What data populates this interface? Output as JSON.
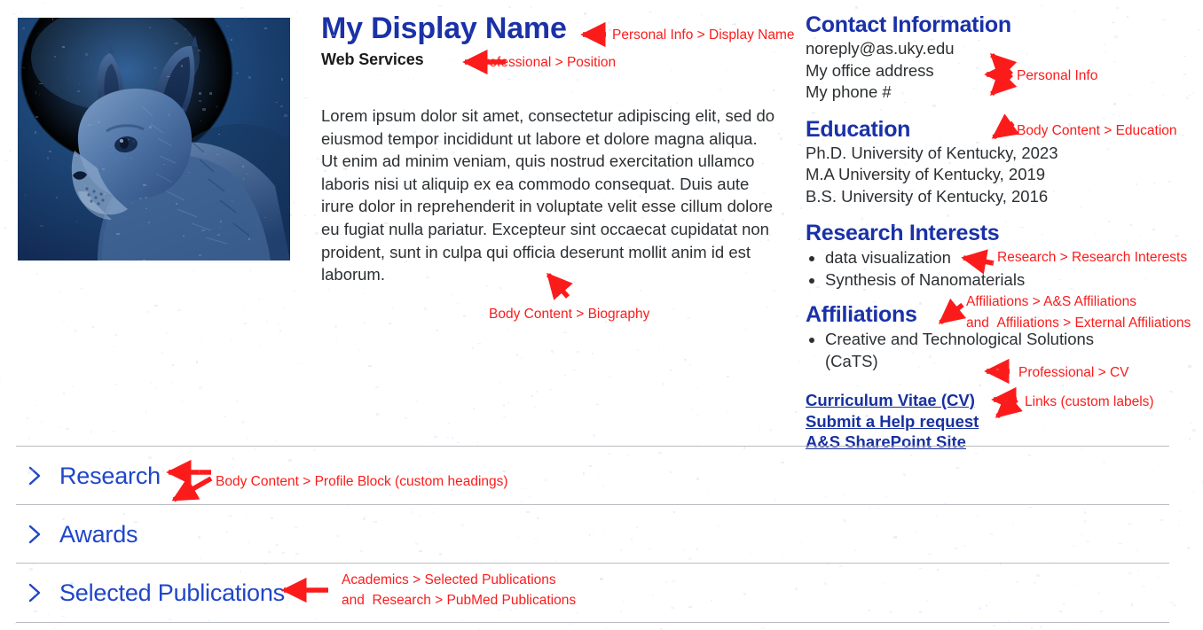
{
  "colors": {
    "heading_blue": "#1a31a8",
    "accordion_blue": "#2046c8",
    "link_blue": "#18309f",
    "annotation_red": "#fc1b1b",
    "body_text": "#2c3033",
    "rule_gray": "#b9bcc0"
  },
  "profile": {
    "photo_alt": "profile-photo-lynx",
    "display_name": "My Display Name",
    "position": "Web Services",
    "biography": "Lorem ipsum dolor sit amet, consectetur adipiscing elit, sed do eiusmod tempor incididunt ut labore et dolore magna aliqua. Ut enim ad minim veniam, quis nostrud exercitation ullamco laboris nisi ut aliquip ex ea commodo consequat. Duis aute irure dolor in reprehenderit in voluptate velit esse cillum dolore eu fugiat nulla pariatur. Excepteur sint occaecat cupidatat non proident, sunt in culpa qui officia deserunt mollit anim id est laborum."
  },
  "rail": {
    "contact": {
      "heading": "Contact Information",
      "email": "noreply@as.uky.edu",
      "address": "My office address",
      "phone": "My phone #"
    },
    "education": {
      "heading": "Education",
      "items": [
        "Ph.D. University of Kentucky, 2023",
        "M.A University of Kentucky, 2019",
        "B.S. University of Kentucky, 2016"
      ]
    },
    "research_interests": {
      "heading": "Research Interests",
      "items": [
        "data visualization",
        "Synthesis of Nanomaterials"
      ]
    },
    "affiliations": {
      "heading": "Affiliations",
      "items": [
        "Creative and Technological Solutions (CaTS)"
      ]
    },
    "links": [
      {
        "label": "Curriculum Vitae (CV)"
      },
      {
        "label": "Submit a Help request"
      },
      {
        "label": "A&S SharePoint Site"
      }
    ]
  },
  "accordions": [
    {
      "label": "Research",
      "icon": "chevron-right-icon",
      "expanded": false
    },
    {
      "label": "Awards",
      "icon": "chevron-right-icon",
      "expanded": false
    },
    {
      "label": "Selected Publications",
      "icon": "chevron-right-icon",
      "expanded": false
    }
  ],
  "annotations": {
    "display_name": "Personal Info > Display Name",
    "position": "Professional > Position",
    "biography": "Body Content > Biography",
    "personal_info": "Personal Info",
    "education": "Body Content > Education",
    "research_interests": "Research > Research Interests",
    "affiliations_line1": "Affiliations > A&S Affiliations",
    "affiliations_and": "and",
    "affiliations_line2": "Affiliations > External Affiliations",
    "cv": "Professional > CV",
    "links": "Links (custom labels)",
    "profile_block": "Body Content > Profile Block (custom headings)",
    "publications_line1": "Academics > Selected Publications",
    "publications_and": "and",
    "publications_line2": "Research > PubMed Publications"
  }
}
